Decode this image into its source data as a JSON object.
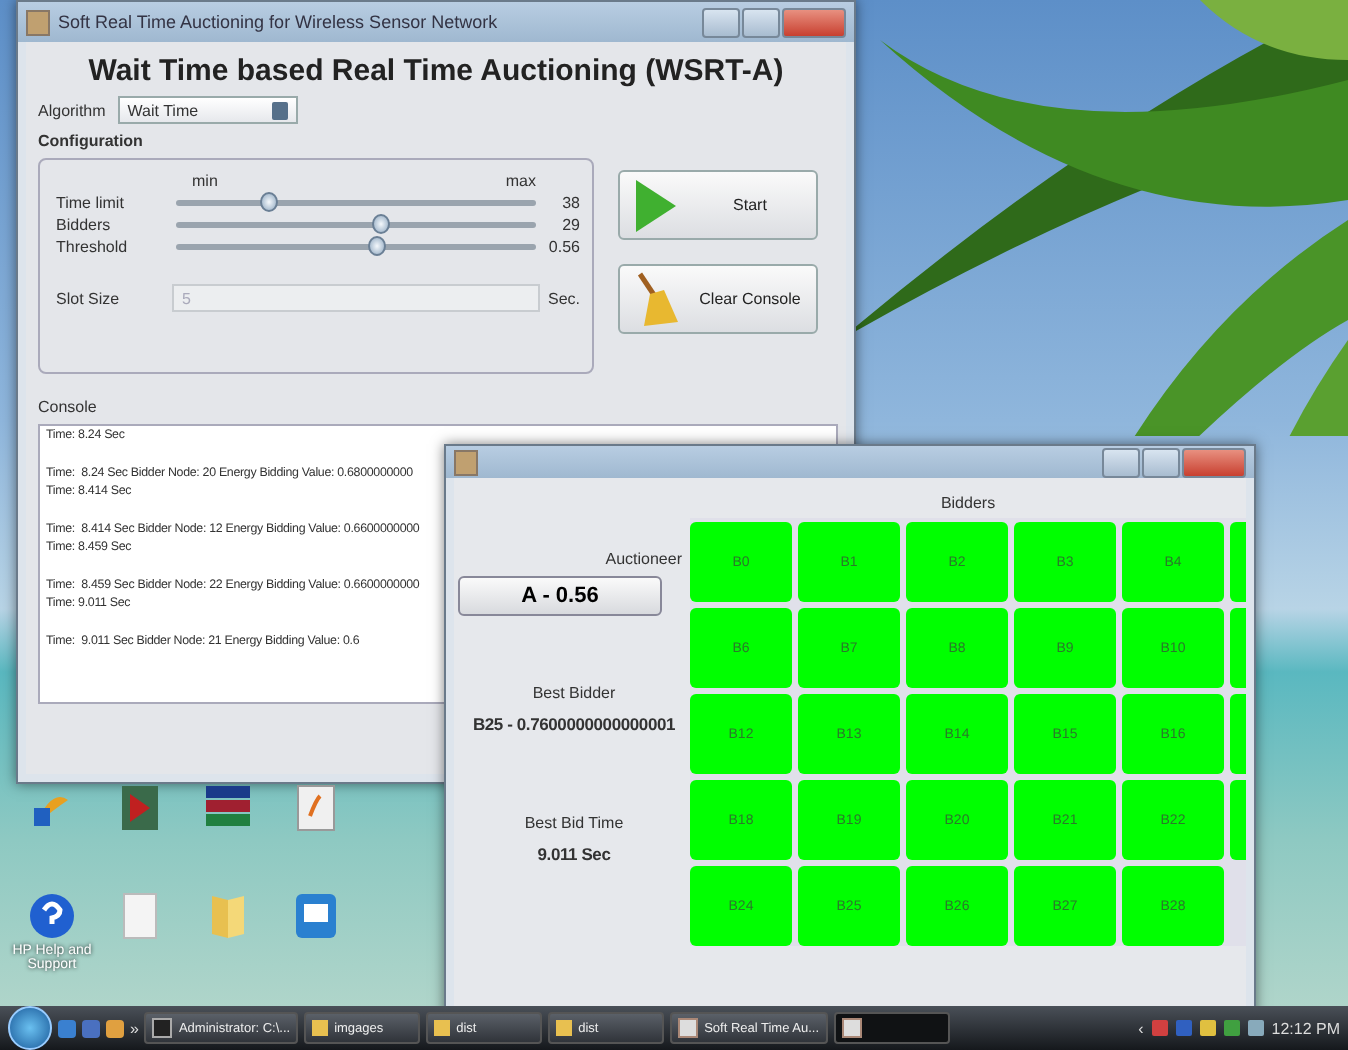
{
  "main_window": {
    "title": "Soft Real Time Auctioning for Wireless Sensor Network",
    "heading": "Wait Time based Real Time Auctioning (WSRT-A)",
    "algorithm": {
      "label": "Algorithm",
      "value": "Wait Time"
    },
    "configuration": {
      "label": "Configuration",
      "min_label": "min",
      "max_label": "max",
      "sliders": [
        {
          "name": "Time limit",
          "level": 0.26,
          "reading": "38"
        },
        {
          "name": "Bidders",
          "level": 0.57,
          "reading": "29"
        },
        {
          "name": "Threshold",
          "level": 0.56,
          "reading": "0.56"
        }
      ],
      "slot_size": {
        "label": "Slot Size",
        "value": "5",
        "unit": "Sec.",
        "disabled": true
      }
    },
    "buttons": [
      {
        "kind": "start",
        "label": "Start"
      },
      {
        "kind": "clear",
        "label": "Clear Console"
      }
    ],
    "console": {
      "label": "Console",
      "entries": [
        {
          "lines": [
            "Time: 8.24 Sec"
          ]
        },
        {
          "lines": [
            "Time:  8.24 Sec Bidder Node: 20 Energy Bidding Value: 0.6800000000",
            "Time: 8.414 Sec"
          ]
        },
        {
          "lines": [
            "Time:  8.414 Sec Bidder Node: 12 Energy Bidding Value: 0.6600000000",
            "Time: 8.459 Sec"
          ]
        },
        {
          "lines": [
            "Time:  8.459 Sec Bidder Node: 22 Energy Bidding Value: 0.6600000000",
            "Time: 9.011 Sec"
          ]
        },
        {
          "lines": [
            "Time:  9.011 Sec Bidder Node: 21 Energy Bidding Value: 0.6"
          ]
        }
      ]
    }
  },
  "bidders_window": {
    "auctioneer_label": "Auctioneer",
    "auctioneer_value": "A - 0.56",
    "best_bidder_label": "Best Bidder",
    "best_bidder_value": "B25 - 0.7600000000000001",
    "best_bid_time_label": "Best Bid Time",
    "best_bid_time_value": "9.011 Sec",
    "bidders_label": "Bidders",
    "rows": [
      {
        "cells": [
          "B0",
          "B1",
          "B2",
          "B3",
          "B4"
        ],
        "cut_cell": true
      },
      {
        "cells": [
          "B6",
          "B7",
          "B8",
          "B9",
          "B10"
        ],
        "cut_cell": true
      },
      {
        "cells": [
          "B12",
          "B13",
          "B14",
          "B15",
          "B16"
        ],
        "cut_cell": true
      },
      {
        "cells": [
          "B18",
          "B19",
          "B20",
          "B21",
          "B22"
        ],
        "cut_cell": true
      },
      {
        "cells": [
          "B24",
          "B25",
          "B26",
          "B27",
          "B28"
        ],
        "cut_cell": false
      }
    ]
  },
  "desktop_icons": [
    {
      "kind": "pdf"
    },
    {
      "kind": "app"
    },
    {
      "kind": "archive"
    },
    {
      "kind": "java"
    },
    {
      "kind": "help",
      "label": "HP Help and Support"
    },
    {
      "kind": "doc"
    },
    {
      "kind": "folder"
    },
    {
      "kind": "remote"
    }
  ],
  "taskbar": {
    "overflow": "»",
    "buttons": [
      {
        "kind": "console",
        "label": "Administrator: C:\\..."
      },
      {
        "kind": "folder",
        "label": "imgages"
      },
      {
        "kind": "folder",
        "label": "dist"
      },
      {
        "kind": "folder",
        "label": "dist"
      },
      {
        "kind": "java",
        "label": "Soft Real Time Au..."
      },
      {
        "kind": "java"
      }
    ],
    "tray_arrow": "‹",
    "clock": "12:12 PM"
  }
}
